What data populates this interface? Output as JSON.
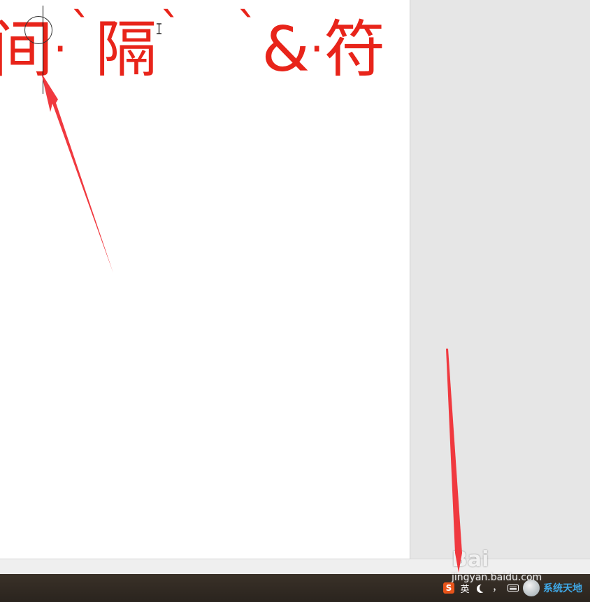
{
  "document": {
    "text_line": {
      "part1": "间",
      "dot1": "·",
      "tick1": "`",
      "char2": "隔",
      "tick2": "`",
      "tick3": "`",
      "amp": "&",
      "dot2": "·",
      "char3": "符"
    },
    "text_color": "#e8241a"
  },
  "taskbar": {
    "ime_icon": "S",
    "ime_lang": "英",
    "punct": "，",
    "brand_logo_text": "系统天地"
  },
  "watermark": {
    "logo": "Bai",
    "url": "jingyan.baidu.com"
  },
  "icons": {
    "cursor": "text-cursor",
    "ring": "click-highlight-circle",
    "ibeam": "i-beam-cursor-icon",
    "moon": "moon-icon",
    "keyboard": "keyboard-icon"
  },
  "colors": {
    "annotation_arrow": "#f0393f",
    "panel": "#e6e6e6",
    "taskbar": "#2f2922"
  }
}
